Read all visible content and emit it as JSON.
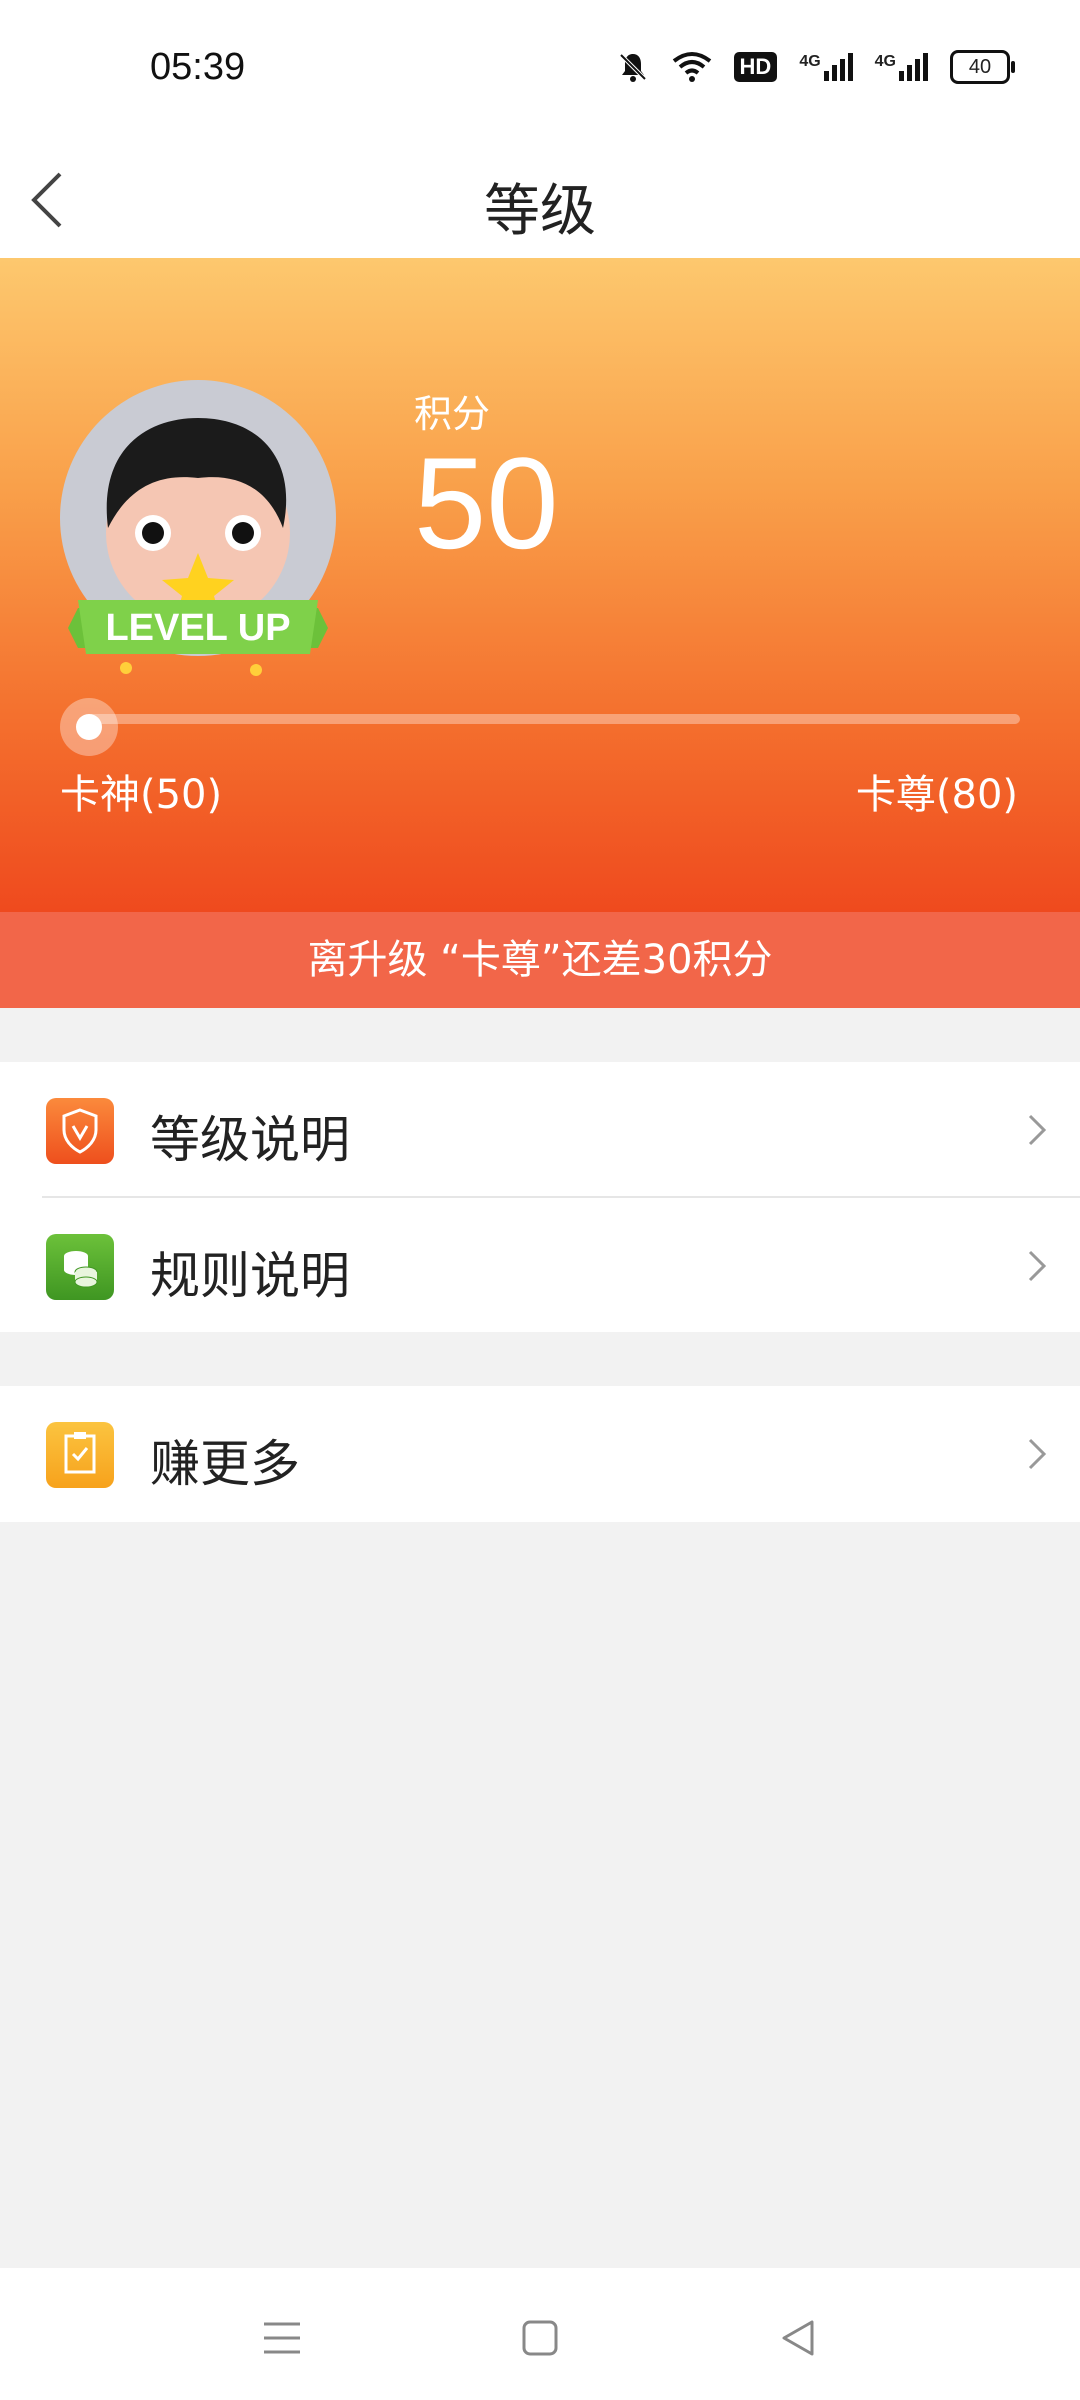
{
  "status_bar": {
    "time": "05:39",
    "hd_label": "HD",
    "net1": "4G",
    "net2": "4G",
    "battery": "40"
  },
  "header": {
    "title": "等级"
  },
  "hero": {
    "score_label": "积分",
    "score_value": "50",
    "avatar_banner": "LEVEL UP",
    "current_level": "卡神(50)",
    "next_level": "卡尊(80)",
    "progress_fraction": 0.0,
    "upgrade_hint": "离升级 “卡尊”还差30积分"
  },
  "menu": {
    "group1": [
      {
        "label": "等级说明",
        "icon": "shield-v-icon",
        "color": "#f05a22"
      },
      {
        "label": "规则说明",
        "icon": "coins-icon",
        "color": "#4aa32a"
      }
    ],
    "group2": [
      {
        "label": "赚更多",
        "icon": "clipboard-check-icon",
        "color": "#f7a21c"
      }
    ]
  },
  "colors": {
    "accent": "#f26649",
    "hero_top": "#fdc86e",
    "hero_bottom": "#ef4a1e"
  }
}
